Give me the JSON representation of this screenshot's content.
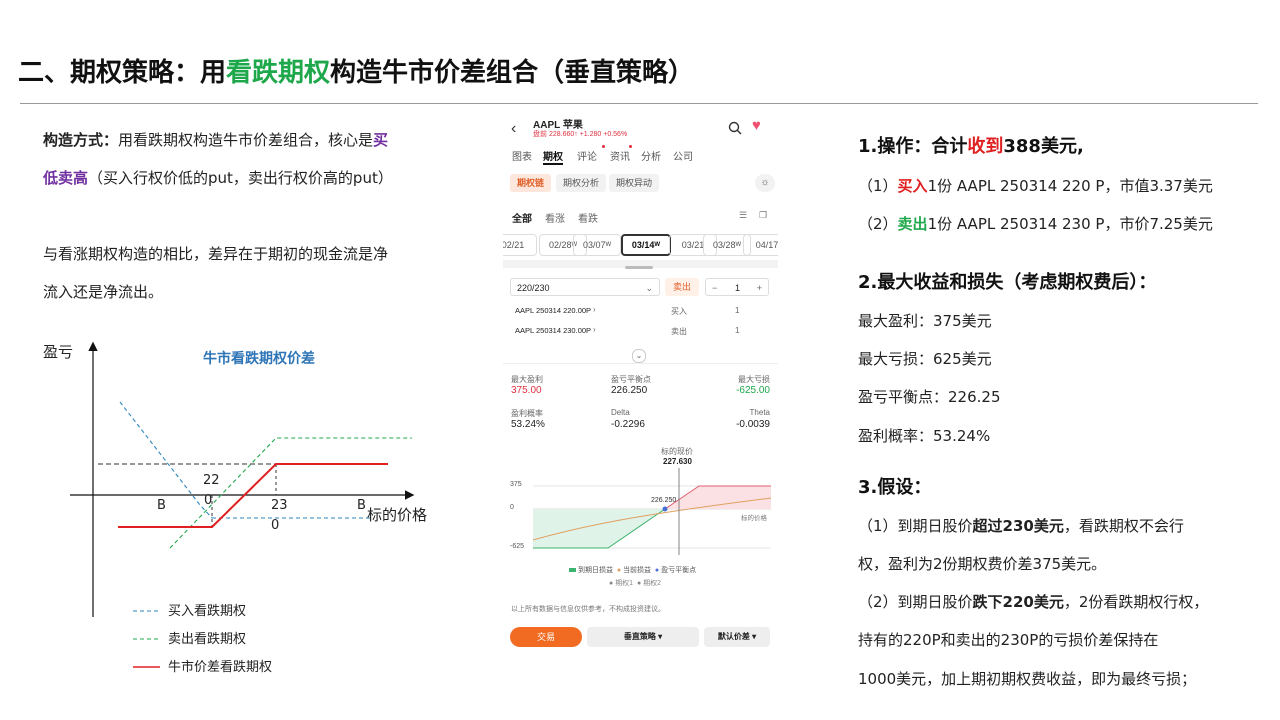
{
  "title": {
    "prefix": "二、期权策略：用",
    "highlight": "看跌期权",
    "suffix": "构造牛市价差组合（垂直策略）"
  },
  "left": {
    "p1_label": "构造方式：",
    "p1_text": "用看跌期权构造牛市价差组合，核心是",
    "p1_hl1": "买",
    "p1_hl2": "低卖高",
    "p1_tail": "（买入行权价低的put，卖出行权价高的put）",
    "p2_line1": "与看涨期权构造的相比，差异在于期初的现金流是净",
    "p2_line2": "流入还是净流出。"
  },
  "diagram": {
    "y_label": "盈亏",
    "x_label": "标的价格",
    "chart_title": "牛市看跌期权价差",
    "strike_low_a": "22",
    "strike_low_b": "0",
    "strike_high_a": "23",
    "strike_high_b": "0",
    "b1": "B",
    "b2": "B",
    "legend": [
      "买入看跌期权",
      "卖出看跌期权",
      "牛市价差看跌期权"
    ],
    "colors": {
      "buy": "#2e86c1",
      "sell": "#1ea84b",
      "spread": "#e02020"
    }
  },
  "phone": {
    "symbol": "AAPL 苹果",
    "quote": "盘前 228.660↑ +1.280 +0.56%",
    "tabs": [
      "图表",
      "期权",
      "评论",
      "资讯",
      "分析",
      "公司"
    ],
    "subtabs": [
      "期权链",
      "期权分析",
      "期权异动"
    ],
    "filters": [
      "全部",
      "看涨",
      "看跌"
    ],
    "dates": [
      "02/21",
      "02/28ᵂ",
      "03/07ᵂ",
      "03/14ᵂ",
      "03/21",
      "03/28ᵂ",
      "04/17"
    ],
    "combo": "220/230",
    "side": "卖出",
    "qty": "1",
    "legs": [
      {
        "name": "AAPL 250314 220.00P",
        "side": "买入",
        "qty": "1"
      },
      {
        "name": "AAPL 250314 230.00P",
        "side": "卖出",
        "qty": "1"
      }
    ],
    "stats": [
      {
        "label": "最大盈利",
        "value": "375.00"
      },
      {
        "label": "盈亏平衡点",
        "value": "226.250"
      },
      {
        "label": "最大亏损",
        "value": "-625.00"
      },
      {
        "label": "盈利概率",
        "value": "53.24%"
      },
      {
        "label": "Delta",
        "value": "-0.2296"
      },
      {
        "label": "Theta",
        "value": "-0.0039"
      }
    ],
    "price_label": "标的现价",
    "price": "227.630",
    "axis": [
      "375",
      "0",
      "-625"
    ],
    "breakeven": "226.250",
    "x_axis_label": "标的价格",
    "legend": [
      "到期日损益",
      "当前损益",
      "盈亏平衡点"
    ],
    "legend2": [
      "期权1",
      "期权2"
    ],
    "disclaimer": "以上所有数据与信息仅供参考，不构成投资建议。",
    "buttons": [
      "交易",
      "垂直策略 ▾",
      "默认价差 ▾"
    ]
  },
  "right": {
    "h1_a": "1.操作：合计",
    "h1_b": "收到",
    "h1_c": "388美元,",
    "op1_a": "（1）",
    "op1_b": "买入",
    "op1_c": "1份 AAPL 250314 220 P，市值3.37美元",
    "op2_a": "（2）",
    "op2_b": "卖出",
    "op2_c": "1份 AAPL 250314 230 P，市价7.25美元",
    "h2": "2.最大收益和损失（考虑期权费后）：",
    "s1": "最大盈利：375美元",
    "s2": "最大亏损：625美元",
    "s3": "盈亏平衡点：226.25",
    "s4": "盈利概率：53.24%",
    "h3": "3.假设：",
    "a1_a": "（1）到期日股价",
    "a1_b": "超过230美元",
    "a1_c": "，看跌期权不会行",
    "a1_d": "权，盈利为2份期权费价差375美元。",
    "a2_a": "（2）到期日股价",
    "a2_b": "跌下220美元",
    "a2_c": "，2份看跌期权行权，",
    "a2_d": "持有的220P和卖出的230P的亏损价差保持在",
    "a2_e": "1000美元，加上期初期权费收益，即为最终亏损；"
  }
}
